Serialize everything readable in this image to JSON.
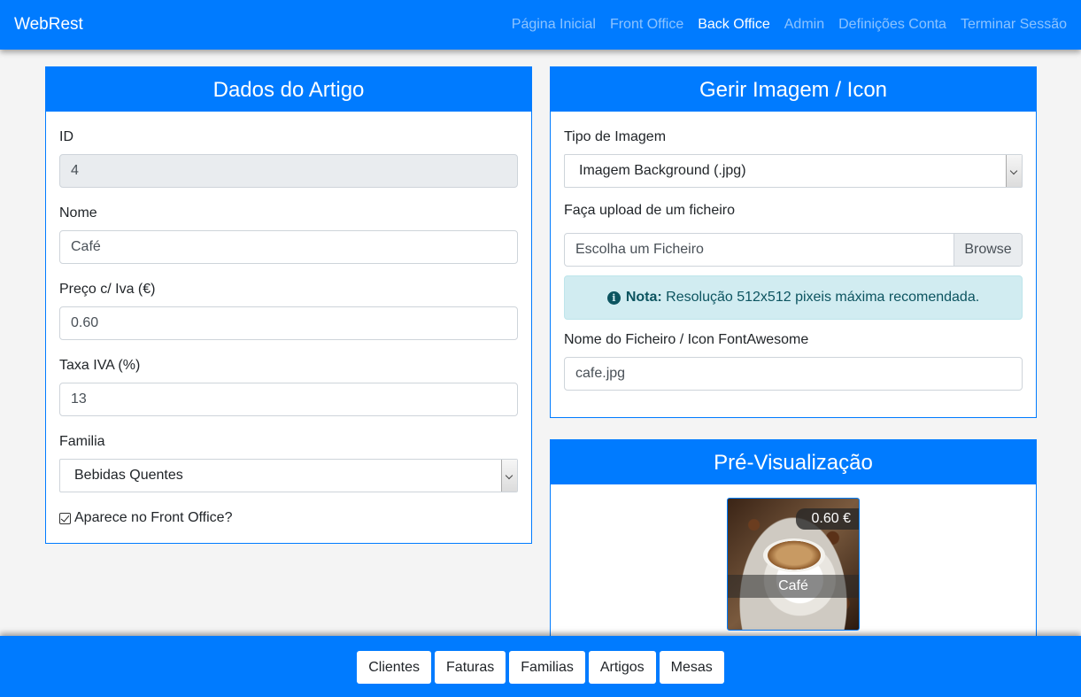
{
  "navbar": {
    "brand": "WebRest",
    "links": [
      "Página Inicial",
      "Front Office",
      "Back Office",
      "Admin",
      "Definições Conta",
      "Terminar Sessão"
    ],
    "active": "Back Office"
  },
  "artigo": {
    "title": "Dados do Artigo",
    "id_label": "ID",
    "id_value": "4",
    "nome_label": "Nome",
    "nome_value": "Café",
    "preco_label": "Preço c/ Iva (€)",
    "preco_value": "0.60",
    "taxa_label": "Taxa IVA (%)",
    "taxa_value": "13",
    "familia_label": "Familia",
    "familia_value": "Bebidas Quentes",
    "front_office_label": "Aparece no Front Office?",
    "front_office_checked": true
  },
  "imagem": {
    "title": "Gerir Imagem / Icon",
    "tipo_label": "Tipo de Imagem",
    "tipo_value": "Imagem Background (.jpg)",
    "upload_label": "Faça upload de um ficheiro",
    "upload_placeholder": "Escolha um Ficheiro",
    "browse_label": "Browse",
    "nota_strong": "Nota:",
    "nota_text": " Resolução 512x512 pixeis máxima recomendada.",
    "ficheiro_label": "Nome do Ficheiro / Icon FontAwesome",
    "ficheiro_value": "cafe.jpg"
  },
  "preview": {
    "title": "Pré-Visualização",
    "price": "0.60 €",
    "name": "Café"
  },
  "footer": {
    "buttons": [
      "Clientes",
      "Faturas",
      "Familias",
      "Artigos",
      "Mesas"
    ]
  },
  "colors": {
    "primary": "#007bff",
    "info_bg": "#d1ecf1",
    "info_text": "#0c5460"
  }
}
